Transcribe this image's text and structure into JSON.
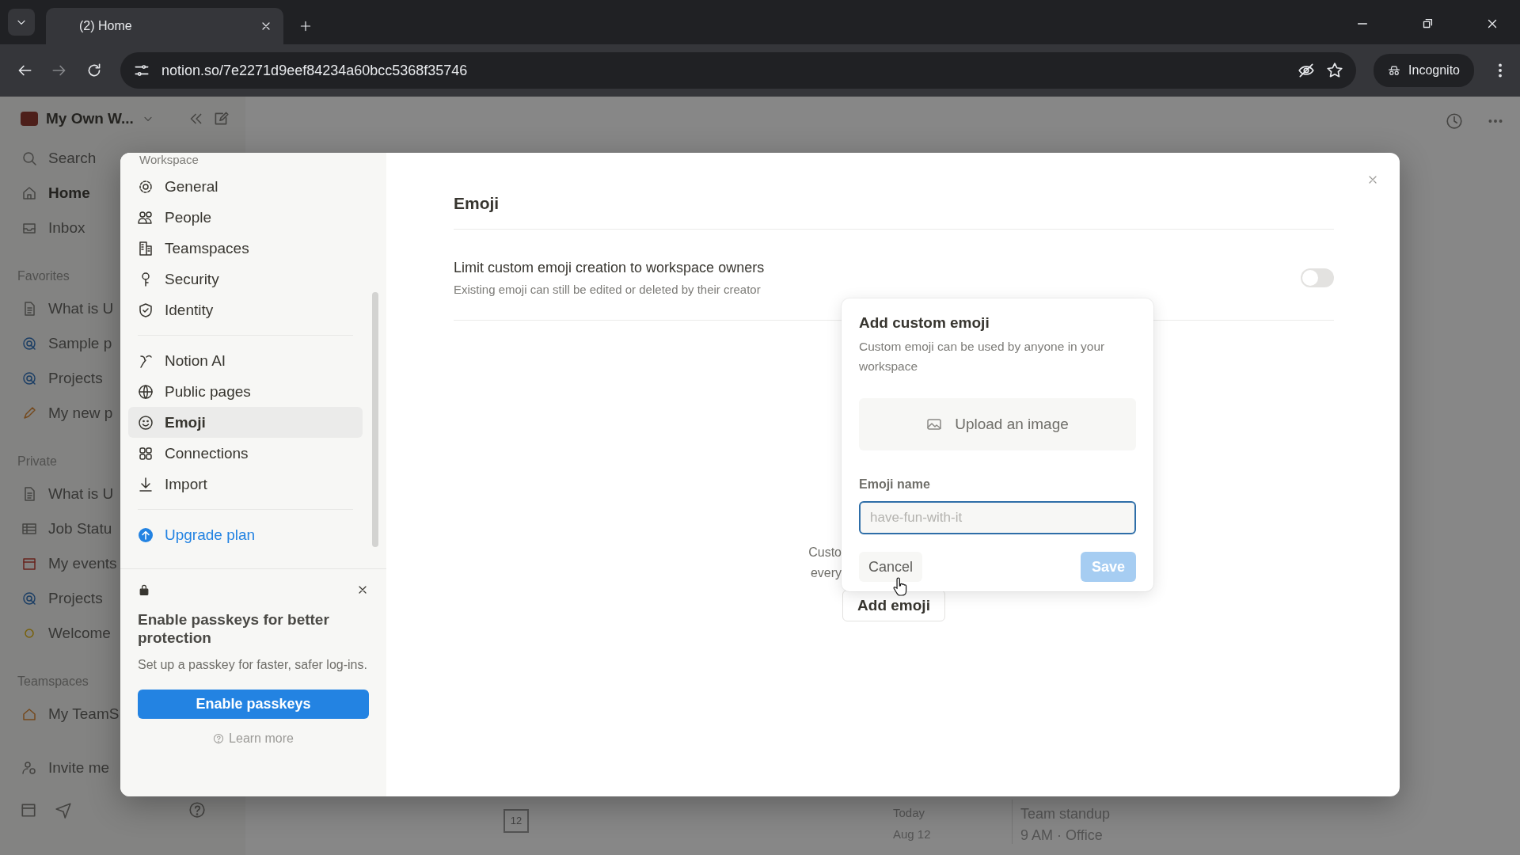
{
  "browser": {
    "tab_title": "(2) Home",
    "address": "notion.so/7e2271d9eef84234a60bcc5368f35746",
    "incognito_label": "Incognito"
  },
  "sidebar": {
    "workspace_name": "My Own W...",
    "nav": [
      {
        "label": "Search",
        "selected": false
      },
      {
        "label": "Home",
        "selected": true
      },
      {
        "label": "Inbox",
        "selected": false
      }
    ],
    "sections": [
      {
        "title": "Favorites",
        "items": [
          {
            "label": "What is U"
          },
          {
            "label": "Sample p"
          },
          {
            "label": "Projects"
          },
          {
            "label": "My new p"
          }
        ]
      },
      {
        "title": "Private",
        "items": [
          {
            "label": "What is U"
          },
          {
            "label": "Job Statu"
          },
          {
            "label": "My events"
          },
          {
            "label": "Projects"
          },
          {
            "label": "Welcome"
          }
        ]
      },
      {
        "title": "Teamspaces",
        "items": [
          {
            "label": "My TeamS"
          }
        ]
      }
    ],
    "invite": "Invite me"
  },
  "agenda": {
    "date_icon": "12",
    "day": "Today",
    "date": "Aug 12",
    "event": "Team standup",
    "detail": "9 AM · Office"
  },
  "modal": {
    "nav": {
      "section": "Workspace",
      "groups": [
        [
          {
            "label": "General",
            "selected": false
          },
          {
            "label": "People",
            "selected": false
          },
          {
            "label": "Teamspaces",
            "selected": false
          },
          {
            "label": "Security",
            "selected": false
          },
          {
            "label": "Identity",
            "selected": false
          }
        ],
        [
          {
            "label": "Notion AI",
            "selected": false
          },
          {
            "label": "Public pages",
            "selected": false
          },
          {
            "label": "Emoji",
            "selected": true
          },
          {
            "label": "Connections",
            "selected": false
          },
          {
            "label": "Import",
            "selected": false
          }
        ]
      ],
      "upgrade": "Upgrade plan"
    },
    "passkey": {
      "title": "Enable passkeys for better protection",
      "text": "Set up a passkey for faster, safer log-ins.",
      "button": "Enable passkeys",
      "link": "Learn more"
    },
    "title": "Emoji",
    "setting": {
      "label": "Limit custom emoji creation to workspace owners",
      "description": "Existing emoji can still be edited or deleted by their creator",
      "on": false
    },
    "empty_text": [
      "Custo",
      "every"
    ],
    "add_button": "Add emoji",
    "popup": {
      "title": "Add custom emoji",
      "description": "Custom emoji can be used by anyone in your workspace",
      "upload": "Upload an image",
      "field_label": "Emoji name",
      "placeholder": "have-fun-with-it",
      "cancel": "Cancel",
      "save": "Save",
      "save_disabled": true
    }
  }
}
